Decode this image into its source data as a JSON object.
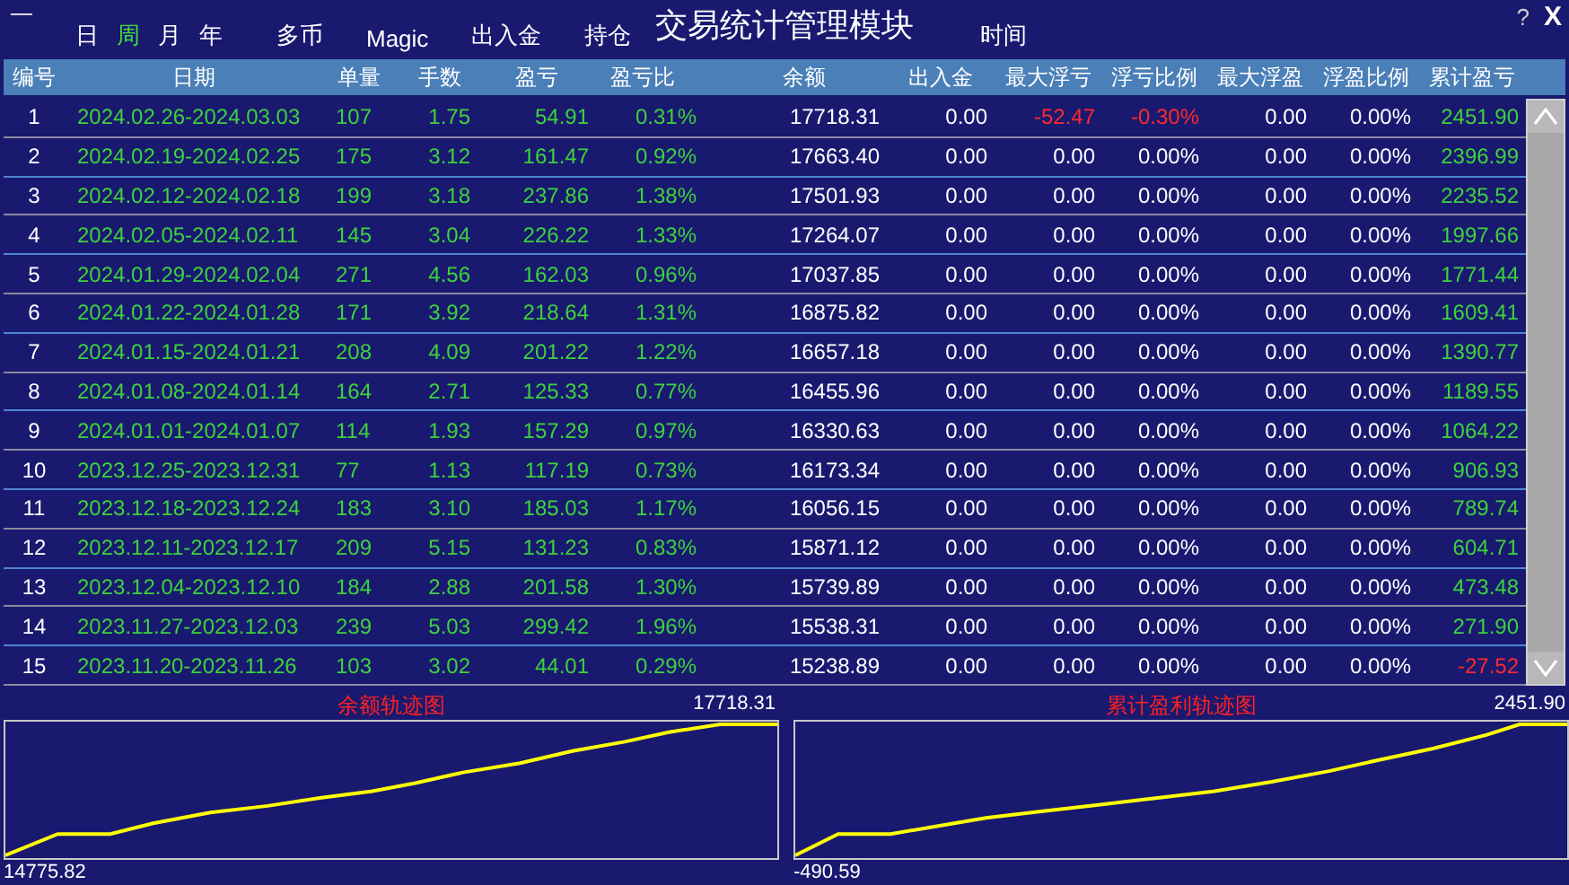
{
  "window": {
    "title": "交易统计管理模块",
    "minimize": "—",
    "help": "?",
    "close": "X"
  },
  "periods": [
    {
      "label": "日",
      "selected": false
    },
    {
      "label": "周",
      "selected": true
    },
    {
      "label": "月",
      "selected": false
    },
    {
      "label": "年",
      "selected": false
    }
  ],
  "menu": [
    "多币",
    "Magic",
    "出入金",
    "持仓"
  ],
  "time_label": "时间",
  "table": {
    "columns": [
      "编号",
      "日期",
      "单量",
      "手数",
      "盈亏",
      "盈亏比",
      "余额",
      "出入金",
      "最大浮亏",
      "浮亏比例",
      "最大浮盈",
      "浮盈比例",
      "累计盈亏"
    ],
    "rows": [
      {
        "cells": [
          "1",
          "2024.02.26-2024.03.03",
          "107",
          "1.75",
          "54.91",
          "0.31%",
          "17718.31",
          "0.00",
          "-52.47",
          "-0.30%",
          "0.00",
          "0.00%",
          "2451.90"
        ],
        "negative_float": true,
        "negative_total": false
      },
      {
        "cells": [
          "2",
          "2024.02.19-2024.02.25",
          "175",
          "3.12",
          "161.47",
          "0.92%",
          "17663.40",
          "0.00",
          "0.00",
          "0.00%",
          "0.00",
          "0.00%",
          "2396.99"
        ],
        "negative_float": false,
        "negative_total": false
      },
      {
        "cells": [
          "3",
          "2024.02.12-2024.02.18",
          "199",
          "3.18",
          "237.86",
          "1.38%",
          "17501.93",
          "0.00",
          "0.00",
          "0.00%",
          "0.00",
          "0.00%",
          "2235.52"
        ],
        "negative_float": false,
        "negative_total": false
      },
      {
        "cells": [
          "4",
          "2024.02.05-2024.02.11",
          "145",
          "3.04",
          "226.22",
          "1.33%",
          "17264.07",
          "0.00",
          "0.00",
          "0.00%",
          "0.00",
          "0.00%",
          "1997.66"
        ],
        "negative_float": false,
        "negative_total": false
      },
      {
        "cells": [
          "5",
          "2024.01.29-2024.02.04",
          "271",
          "4.56",
          "162.03",
          "0.96%",
          "17037.85",
          "0.00",
          "0.00",
          "0.00%",
          "0.00",
          "0.00%",
          "1771.44"
        ],
        "negative_float": false,
        "negative_total": false
      },
      {
        "cells": [
          "6",
          "2024.01.22-2024.01.28",
          "171",
          "3.92",
          "218.64",
          "1.31%",
          "16875.82",
          "0.00",
          "0.00",
          "0.00%",
          "0.00",
          "0.00%",
          "1609.41"
        ],
        "negative_float": false,
        "negative_total": false
      },
      {
        "cells": [
          "7",
          "2024.01.15-2024.01.21",
          "208",
          "4.09",
          "201.22",
          "1.22%",
          "16657.18",
          "0.00",
          "0.00",
          "0.00%",
          "0.00",
          "0.00%",
          "1390.77"
        ],
        "negative_float": false,
        "negative_total": false
      },
      {
        "cells": [
          "8",
          "2024.01.08-2024.01.14",
          "164",
          "2.71",
          "125.33",
          "0.77%",
          "16455.96",
          "0.00",
          "0.00",
          "0.00%",
          "0.00",
          "0.00%",
          "1189.55"
        ],
        "negative_float": false,
        "negative_total": false
      },
      {
        "cells": [
          "9",
          "2024.01.01-2024.01.07",
          "114",
          "1.93",
          "157.29",
          "0.97%",
          "16330.63",
          "0.00",
          "0.00",
          "0.00%",
          "0.00",
          "0.00%",
          "1064.22"
        ],
        "negative_float": false,
        "negative_total": false
      },
      {
        "cells": [
          "10",
          "2023.12.25-2023.12.31",
          "77",
          "1.13",
          "117.19",
          "0.73%",
          "16173.34",
          "0.00",
          "0.00",
          "0.00%",
          "0.00",
          "0.00%",
          "906.93"
        ],
        "negative_float": false,
        "negative_total": false
      },
      {
        "cells": [
          "11",
          "2023.12.18-2023.12.24",
          "183",
          "3.10",
          "185.03",
          "1.17%",
          "16056.15",
          "0.00",
          "0.00",
          "0.00%",
          "0.00",
          "0.00%",
          "789.74"
        ],
        "negative_float": false,
        "negative_total": false
      },
      {
        "cells": [
          "12",
          "2023.12.11-2023.12.17",
          "209",
          "5.15",
          "131.23",
          "0.83%",
          "15871.12",
          "0.00",
          "0.00",
          "0.00%",
          "0.00",
          "0.00%",
          "604.71"
        ],
        "negative_float": false,
        "negative_total": false
      },
      {
        "cells": [
          "13",
          "2023.12.04-2023.12.10",
          "184",
          "2.88",
          "201.58",
          "1.30%",
          "15739.89",
          "0.00",
          "0.00",
          "0.00%",
          "0.00",
          "0.00%",
          "473.48"
        ],
        "negative_float": false,
        "negative_total": false
      },
      {
        "cells": [
          "14",
          "2023.11.27-2023.12.03",
          "239",
          "5.03",
          "299.42",
          "1.96%",
          "15538.31",
          "0.00",
          "0.00",
          "0.00%",
          "0.00",
          "0.00%",
          "271.90"
        ],
        "negative_float": false,
        "negative_total": false
      },
      {
        "cells": [
          "15",
          "2023.11.20-2023.11.26",
          "103",
          "3.02",
          "44.01",
          "0.29%",
          "15238.89",
          "0.00",
          "0.00",
          "0.00%",
          "0.00",
          "0.00%",
          "-27.52"
        ],
        "negative_float": false,
        "negative_total": true
      }
    ]
  },
  "charts": [
    {
      "title": "余额轨迹图",
      "max_label": "17718.31",
      "min_label": "14775.82"
    },
    {
      "title": "累计盈利轨迹图",
      "max_label": "2451.90",
      "min_label": "-490.59"
    }
  ]
}
